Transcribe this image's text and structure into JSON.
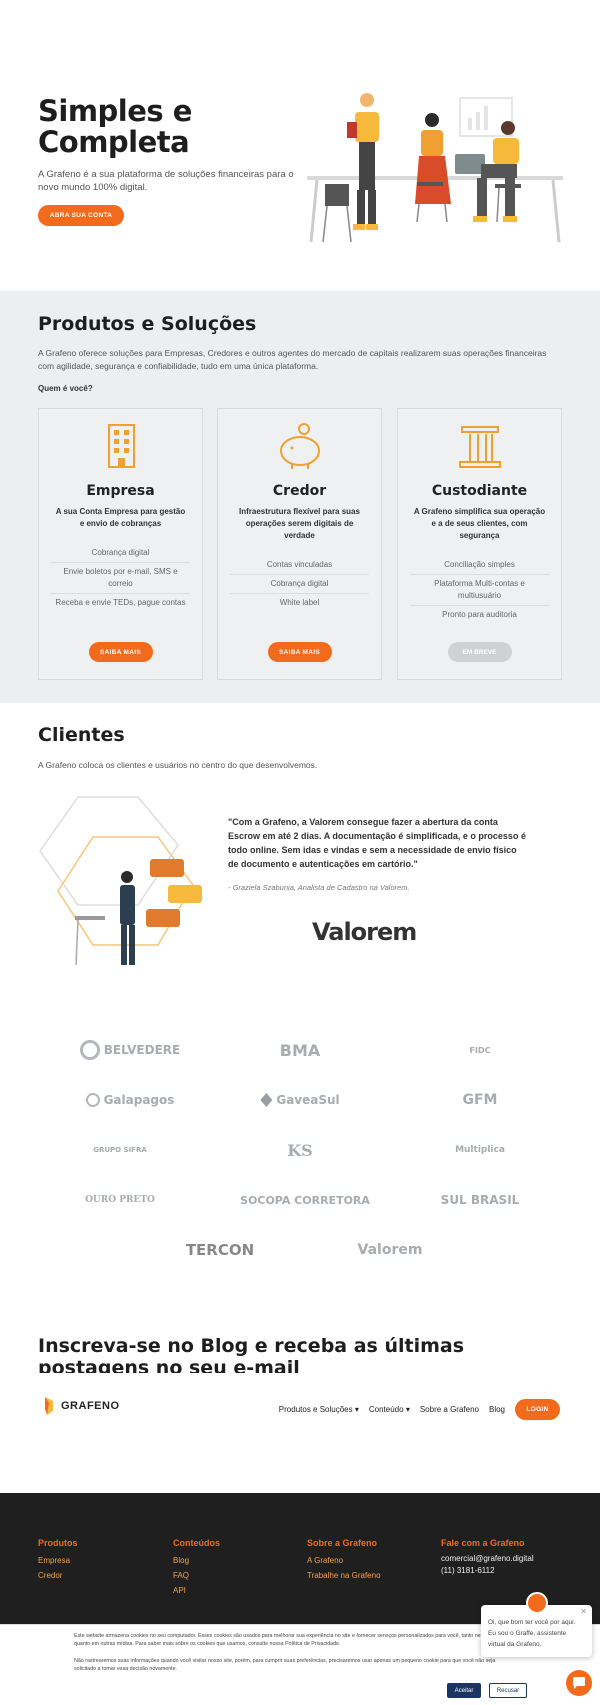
{
  "hero": {
    "title_line1": "Simples e",
    "title_line2": "Completa",
    "subtitle": "A Grafeno é a sua plataforma de soluções financeiras para o novo mundo 100% digital.",
    "cta": "ABRA SUA CONTA"
  },
  "products": {
    "title": "Produtos e Soluções",
    "intro": "A Grafeno oferece soluções para Empresas, Credores e outros agentes do mercado de capitais realizarem suas operações financeiras com agilidade, segurança e confiabilidade, tudo em uma única plataforma.",
    "question": "Quem é você?",
    "cards": [
      {
        "title": "Empresa",
        "desc": "A sua Conta Empresa para gestão e envio de cobranças",
        "items": [
          "Cobrança digital",
          "Envie boletos por e-mail, SMS e correio",
          "Receba e envie TEDs, pague contas"
        ],
        "button": "SAIBA MAIS",
        "icon": "building-icon"
      },
      {
        "title": "Credor",
        "desc": "Infraestrutura flexível para suas operações serem digitais de verdade",
        "items": [
          "Contas vinculadas",
          "Cobrança digital",
          "White label"
        ],
        "button": "SAIBA MAIS",
        "icon": "piggy-bank-icon"
      },
      {
        "title": "Custodiante",
        "desc": "A Grafeno simplifica sua operação e a de seus clientes, com segurança",
        "items": [
          "Conciliação simples",
          "Plataforma Multi-contas e multiusuário",
          "Pronto para auditoria"
        ],
        "button": "EM BREVE",
        "icon": "column-icon"
      }
    ]
  },
  "clients": {
    "title": "Clientes",
    "intro": "A Grafeno coloca os clientes e usuários no centro do que desenvolvemos.",
    "quote": "\"Com a Grafeno, a Valorem consegue fazer a abertura da conta Escrow em até 2 dias. A documentação é simplificada, e o processo é todo online. Sem idas e vindas e sem a necessidade de envio físico de documento e autenticações em cartório.\"",
    "author": "- Graziela Szabunia, Analista de Cadastro na Valorem.",
    "featured_logo": "Valorem",
    "logos": [
      "BELVEDERE",
      "BMA",
      "FIDC",
      "Galapagos",
      "GaveaSul",
      "GFM",
      "GRUPO SIFRA",
      "KS",
      "Multiplica",
      "OURO PRETO",
      "SOCOPA CORRETORA",
      "SUL BRASIL",
      "TERCON",
      "Valorem"
    ]
  },
  "blog": {
    "title": "Inscreva-se no Blog e receba as últimas postagens no seu e-mail"
  },
  "navbar": {
    "brand": "GRAFENO",
    "items": [
      "Produtos e Soluções",
      "Conteúdo",
      "Sobre a Grafeno",
      "Blog"
    ],
    "login": "LOGIN"
  },
  "footer": {
    "cols": [
      {
        "title": "Produtos",
        "links": [
          "Empresa",
          "Credor"
        ]
      },
      {
        "title": "Conteúdos",
        "links": [
          "Blog",
          "FAQ",
          "API"
        ]
      },
      {
        "title": "Sobre a Grafeno",
        "links": [
          "A Grafeno",
          "Trabalhe na Grafeno"
        ]
      },
      {
        "title": "Fale com a Grafeno",
        "lines": [
          "comercial@grafeno.digital",
          "(11) 3181-6112"
        ]
      }
    ]
  },
  "cookie": {
    "text1": "Este website armazena cookies no seu computador. Esses cookies são usados para melhorar sua experiência no site e fornecer serviços personalizados para você, tanto neste website, quanto em outras mídias. Para saber mais sobre os cookies que usamos, consulte nossa Política de Privacidade.",
    "text2": "Não rastrearemos suas informações quando você visitar nosso site, porém, para cumprir suas preferências, precisaremos usar apenas um pequeno cookie para que você não seja solicitado a tomar essa decisão novamente.",
    "accept": "Aceitar",
    "reject": "Recusar"
  },
  "chat": {
    "message": "Oi, que bom ter você por aqui. Eu sou o Graffe, assistente virtual da Grafeno.",
    "close": "✕"
  },
  "colors": {
    "accent": "#f26b1d",
    "dark": "#1f1f1f",
    "section_bg": "#edeeef"
  }
}
